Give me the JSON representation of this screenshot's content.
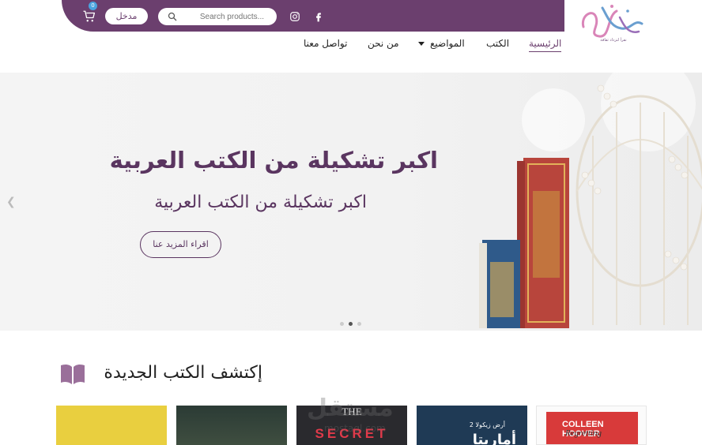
{
  "header": {
    "cart_count": "0",
    "login_label": "مدخل",
    "search_placeholder": "Search products...",
    "logo_tagline": "نقرأ لتزداد ثقافة"
  },
  "nav": {
    "home": "الرئيسية",
    "books": "الكتب",
    "topics": "المواضيع",
    "about": "من نحن",
    "contact": "تواصل معنا"
  },
  "hero": {
    "title": "اكبر تشكيلة من الكتب العربية",
    "subtitle": "اكبر تشكيلة من الكتب العربية",
    "button_label": "اقراء المزيد عنا",
    "slide_count": 3,
    "active_slide": 1
  },
  "section": {
    "title": "إكتشف الكتب الجديدة"
  },
  "books": [
    {
      "cover_text_1": "",
      "cover_text_2": ""
    },
    {
      "cover_text_1": "",
      "cover_text_2": ""
    },
    {
      "cover_text_1": "THE",
      "cover_text_2": "SECRET"
    },
    {
      "cover_text_1": "أرض زيكولا 2",
      "cover_text_2": "أماريتا"
    },
    {
      "cover_text_1": "COLLEEN HOOVER",
      "cover_text_2": "Regretting"
    }
  ],
  "watermark": {
    "text": "مستقل",
    "sub": "mostaql.com"
  },
  "colors": {
    "brand": "#6b3f6e",
    "hero_text": "#5a3560",
    "badge": "#4aa3df"
  }
}
